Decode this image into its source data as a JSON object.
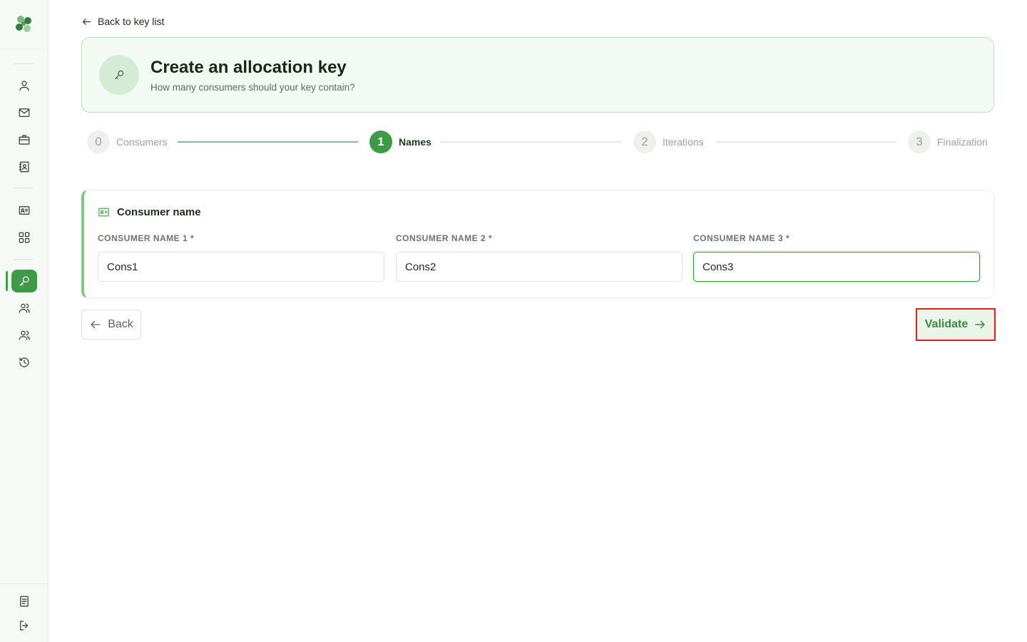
{
  "nav": {
    "logo_icon": "clover-logo",
    "items": [
      {
        "icon": "user-icon"
      },
      {
        "icon": "mail-icon"
      },
      {
        "icon": "briefcase-icon"
      },
      {
        "icon": "contact-book-icon"
      },
      {
        "icon": "id-card-icon"
      },
      {
        "icon": "grid-icon"
      },
      {
        "icon": "key-icon",
        "active": true
      },
      {
        "icon": "users-icon"
      },
      {
        "icon": "users-alt-icon"
      },
      {
        "icon": "history-icon"
      }
    ],
    "bottom": [
      {
        "icon": "document-icon"
      },
      {
        "icon": "logout-icon"
      }
    ]
  },
  "back_link": {
    "label": "Back to key list"
  },
  "header": {
    "title": "Create an allocation key",
    "subtitle": "How many consumers should your key contain?"
  },
  "stepper": {
    "steps": [
      {
        "number": "0",
        "label": "Consumers",
        "state": "done"
      },
      {
        "number": "1",
        "label": "Names",
        "state": "active"
      },
      {
        "number": "2",
        "label": "Iterations",
        "state": "pending"
      },
      {
        "number": "3",
        "label": "Finalization",
        "state": "pending"
      }
    ]
  },
  "form": {
    "title": "Consumer name",
    "fields": [
      {
        "label": "CONSUMER NAME 1 *",
        "value": "Cons1"
      },
      {
        "label": "CONSUMER NAME 2 *",
        "value": "Cons2"
      },
      {
        "label": "CONSUMER NAME 3 *",
        "value": "Cons3"
      }
    ]
  },
  "actions": {
    "back_label": "Back",
    "validate_label": "Validate"
  },
  "colors": {
    "accent": "#3d9a47",
    "highlight": "#e21e1e"
  }
}
